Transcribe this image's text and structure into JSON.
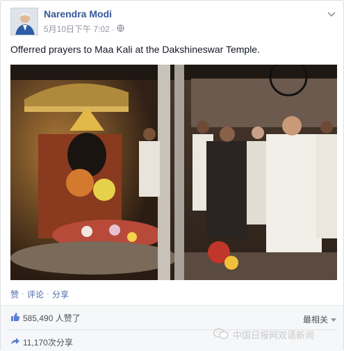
{
  "post": {
    "author": "Narendra Modi",
    "timestamp": "5月10日下午 7:02",
    "separator": "·",
    "privacy_icon": "globe-icon",
    "text": "Offerred prayers to Maa Kali at the Dakshineswar Temple."
  },
  "actions": {
    "like": "赞",
    "comment": "评论",
    "share": "分享",
    "sep": "·"
  },
  "stats": {
    "likes": "585,490 人赞了",
    "shares": "11,170次分享",
    "sort_label": "最相关"
  },
  "watermark": {
    "text": "中国日报网双语新闻"
  },
  "colors": {
    "link": "#365899",
    "muted": "#90949c",
    "bar": "#f6f7f9"
  }
}
